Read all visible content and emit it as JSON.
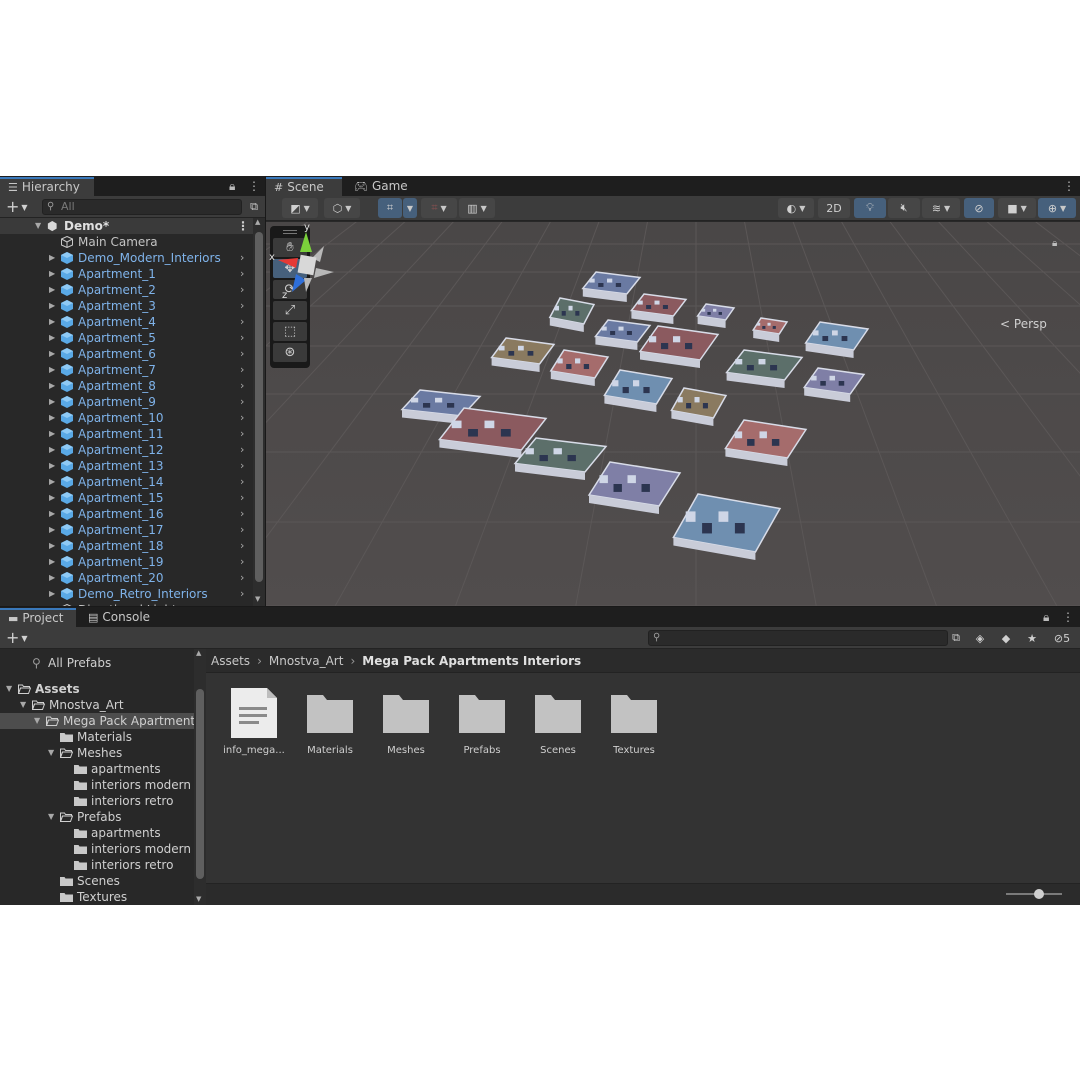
{
  "hierarchy": {
    "tab_label": "Hierarchy",
    "search_placeholder": "All",
    "scene_name": "Demo*",
    "items": [
      {
        "label": "Main Camera",
        "type": "object"
      },
      {
        "label": "Demo_Modern_Interiors",
        "type": "prefab"
      },
      {
        "label": "Apartment_1",
        "type": "prefab"
      },
      {
        "label": "Apartment_2",
        "type": "prefab"
      },
      {
        "label": "Apartment_3",
        "type": "prefab"
      },
      {
        "label": "Apartment_4",
        "type": "prefab"
      },
      {
        "label": "Apartment_5",
        "type": "prefab"
      },
      {
        "label": "Apartment_6",
        "type": "prefab"
      },
      {
        "label": "Apartment_7",
        "type": "prefab"
      },
      {
        "label": "Apartment_8",
        "type": "prefab"
      },
      {
        "label": "Apartment_9",
        "type": "prefab"
      },
      {
        "label": "Apartment_10",
        "type": "prefab"
      },
      {
        "label": "Apartment_11",
        "type": "prefab"
      },
      {
        "label": "Apartment_12",
        "type": "prefab"
      },
      {
        "label": "Apartment_13",
        "type": "prefab"
      },
      {
        "label": "Apartment_14",
        "type": "prefab"
      },
      {
        "label": "Apartment_15",
        "type": "prefab"
      },
      {
        "label": "Apartment_16",
        "type": "prefab"
      },
      {
        "label": "Apartment_17",
        "type": "prefab"
      },
      {
        "label": "Apartment_18",
        "type": "prefab"
      },
      {
        "label": "Apartment_19",
        "type": "prefab"
      },
      {
        "label": "Apartment_20",
        "type": "prefab"
      },
      {
        "label": "Demo_Retro_Interiors",
        "type": "prefab"
      },
      {
        "label": "Directional Light",
        "type": "object"
      }
    ]
  },
  "scene": {
    "tabs": [
      "Scene",
      "Game"
    ],
    "toggle_2d_label": "2D",
    "persp_label": "Persp",
    "gizmo_axes": {
      "x": "x",
      "y": "y",
      "z": "z"
    }
  },
  "project": {
    "tabs": [
      "Project",
      "Console"
    ],
    "hidden_count": "5",
    "all_prefabs_label": "All Prefabs",
    "tree": [
      {
        "label": "Assets",
        "depth": 0,
        "open": true,
        "bold": true,
        "selected": false
      },
      {
        "label": "Mnostva_Art",
        "depth": 1,
        "open": true,
        "bold": false,
        "selected": false
      },
      {
        "label": "Mega Pack Apartments",
        "depth": 2,
        "open": true,
        "bold": false,
        "selected": true
      },
      {
        "label": "Materials",
        "depth": 3,
        "open": null,
        "bold": false,
        "selected": false
      },
      {
        "label": "Meshes",
        "depth": 3,
        "open": true,
        "bold": false,
        "selected": false
      },
      {
        "label": "apartments",
        "depth": 4,
        "open": null,
        "bold": false,
        "selected": false
      },
      {
        "label": "interiors modern",
        "depth": 4,
        "open": null,
        "bold": false,
        "selected": false
      },
      {
        "label": "interiors retro",
        "depth": 4,
        "open": null,
        "bold": false,
        "selected": false
      },
      {
        "label": "Prefabs",
        "depth": 3,
        "open": true,
        "bold": false,
        "selected": false
      },
      {
        "label": "apartments",
        "depth": 4,
        "open": null,
        "bold": false,
        "selected": false
      },
      {
        "label": "interiors modern",
        "depth": 4,
        "open": null,
        "bold": false,
        "selected": false
      },
      {
        "label": "interiors retro",
        "depth": 4,
        "open": null,
        "bold": false,
        "selected": false
      },
      {
        "label": "Scenes",
        "depth": 3,
        "open": null,
        "bold": false,
        "selected": false
      },
      {
        "label": "Textures",
        "depth": 3,
        "open": null,
        "bold": false,
        "selected": false
      }
    ],
    "breadcrumb": [
      "Assets",
      "Mnostva_Art",
      "Mega Pack Apartments Interiors"
    ],
    "assets": [
      {
        "label": "info_mega...",
        "kind": "text-file"
      },
      {
        "label": "Materials",
        "kind": "folder"
      },
      {
        "label": "Meshes",
        "kind": "folder"
      },
      {
        "label": "Prefabs",
        "kind": "folder"
      },
      {
        "label": "Scenes",
        "kind": "folder"
      },
      {
        "label": "Textures",
        "kind": "folder"
      }
    ]
  },
  "colors": {
    "prefab_text": "#7fb3ea",
    "prefab_cube": "#5aa9e6",
    "active_tab": "#3a79bb",
    "toggle_on": "#46607c",
    "scene_bg": "#4d4a4a",
    "folder": "#c2c2c2"
  }
}
